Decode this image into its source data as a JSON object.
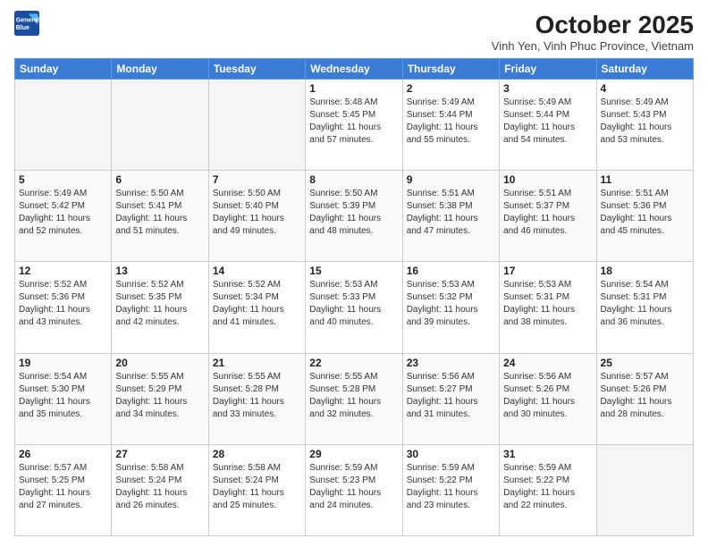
{
  "header": {
    "logo_line1": "General",
    "logo_line2": "Blue",
    "title": "October 2025",
    "subtitle": "Vinh Yen, Vinh Phuc Province, Vietnam"
  },
  "weekdays": [
    "Sunday",
    "Monday",
    "Tuesday",
    "Wednesday",
    "Thursday",
    "Friday",
    "Saturday"
  ],
  "weeks": [
    [
      {
        "day": "",
        "info": ""
      },
      {
        "day": "",
        "info": ""
      },
      {
        "day": "",
        "info": ""
      },
      {
        "day": "1",
        "info": "Sunrise: 5:48 AM\nSunset: 5:45 PM\nDaylight: 11 hours\nand 57 minutes."
      },
      {
        "day": "2",
        "info": "Sunrise: 5:49 AM\nSunset: 5:44 PM\nDaylight: 11 hours\nand 55 minutes."
      },
      {
        "day": "3",
        "info": "Sunrise: 5:49 AM\nSunset: 5:44 PM\nDaylight: 11 hours\nand 54 minutes."
      },
      {
        "day": "4",
        "info": "Sunrise: 5:49 AM\nSunset: 5:43 PM\nDaylight: 11 hours\nand 53 minutes."
      }
    ],
    [
      {
        "day": "5",
        "info": "Sunrise: 5:49 AM\nSunset: 5:42 PM\nDaylight: 11 hours\nand 52 minutes."
      },
      {
        "day": "6",
        "info": "Sunrise: 5:50 AM\nSunset: 5:41 PM\nDaylight: 11 hours\nand 51 minutes."
      },
      {
        "day": "7",
        "info": "Sunrise: 5:50 AM\nSunset: 5:40 PM\nDaylight: 11 hours\nand 49 minutes."
      },
      {
        "day": "8",
        "info": "Sunrise: 5:50 AM\nSunset: 5:39 PM\nDaylight: 11 hours\nand 48 minutes."
      },
      {
        "day": "9",
        "info": "Sunrise: 5:51 AM\nSunset: 5:38 PM\nDaylight: 11 hours\nand 47 minutes."
      },
      {
        "day": "10",
        "info": "Sunrise: 5:51 AM\nSunset: 5:37 PM\nDaylight: 11 hours\nand 46 minutes."
      },
      {
        "day": "11",
        "info": "Sunrise: 5:51 AM\nSunset: 5:36 PM\nDaylight: 11 hours\nand 45 minutes."
      }
    ],
    [
      {
        "day": "12",
        "info": "Sunrise: 5:52 AM\nSunset: 5:36 PM\nDaylight: 11 hours\nand 43 minutes."
      },
      {
        "day": "13",
        "info": "Sunrise: 5:52 AM\nSunset: 5:35 PM\nDaylight: 11 hours\nand 42 minutes."
      },
      {
        "day": "14",
        "info": "Sunrise: 5:52 AM\nSunset: 5:34 PM\nDaylight: 11 hours\nand 41 minutes."
      },
      {
        "day": "15",
        "info": "Sunrise: 5:53 AM\nSunset: 5:33 PM\nDaylight: 11 hours\nand 40 minutes."
      },
      {
        "day": "16",
        "info": "Sunrise: 5:53 AM\nSunset: 5:32 PM\nDaylight: 11 hours\nand 39 minutes."
      },
      {
        "day": "17",
        "info": "Sunrise: 5:53 AM\nSunset: 5:31 PM\nDaylight: 11 hours\nand 38 minutes."
      },
      {
        "day": "18",
        "info": "Sunrise: 5:54 AM\nSunset: 5:31 PM\nDaylight: 11 hours\nand 36 minutes."
      }
    ],
    [
      {
        "day": "19",
        "info": "Sunrise: 5:54 AM\nSunset: 5:30 PM\nDaylight: 11 hours\nand 35 minutes."
      },
      {
        "day": "20",
        "info": "Sunrise: 5:55 AM\nSunset: 5:29 PM\nDaylight: 11 hours\nand 34 minutes."
      },
      {
        "day": "21",
        "info": "Sunrise: 5:55 AM\nSunset: 5:28 PM\nDaylight: 11 hours\nand 33 minutes."
      },
      {
        "day": "22",
        "info": "Sunrise: 5:55 AM\nSunset: 5:28 PM\nDaylight: 11 hours\nand 32 minutes."
      },
      {
        "day": "23",
        "info": "Sunrise: 5:56 AM\nSunset: 5:27 PM\nDaylight: 11 hours\nand 31 minutes."
      },
      {
        "day": "24",
        "info": "Sunrise: 5:56 AM\nSunset: 5:26 PM\nDaylight: 11 hours\nand 30 minutes."
      },
      {
        "day": "25",
        "info": "Sunrise: 5:57 AM\nSunset: 5:26 PM\nDaylight: 11 hours\nand 28 minutes."
      }
    ],
    [
      {
        "day": "26",
        "info": "Sunrise: 5:57 AM\nSunset: 5:25 PM\nDaylight: 11 hours\nand 27 minutes."
      },
      {
        "day": "27",
        "info": "Sunrise: 5:58 AM\nSunset: 5:24 PM\nDaylight: 11 hours\nand 26 minutes."
      },
      {
        "day": "28",
        "info": "Sunrise: 5:58 AM\nSunset: 5:24 PM\nDaylight: 11 hours\nand 25 minutes."
      },
      {
        "day": "29",
        "info": "Sunrise: 5:59 AM\nSunset: 5:23 PM\nDaylight: 11 hours\nand 24 minutes."
      },
      {
        "day": "30",
        "info": "Sunrise: 5:59 AM\nSunset: 5:22 PM\nDaylight: 11 hours\nand 23 minutes."
      },
      {
        "day": "31",
        "info": "Sunrise: 5:59 AM\nSunset: 5:22 PM\nDaylight: 11 hours\nand 22 minutes."
      },
      {
        "day": "",
        "info": ""
      }
    ]
  ]
}
